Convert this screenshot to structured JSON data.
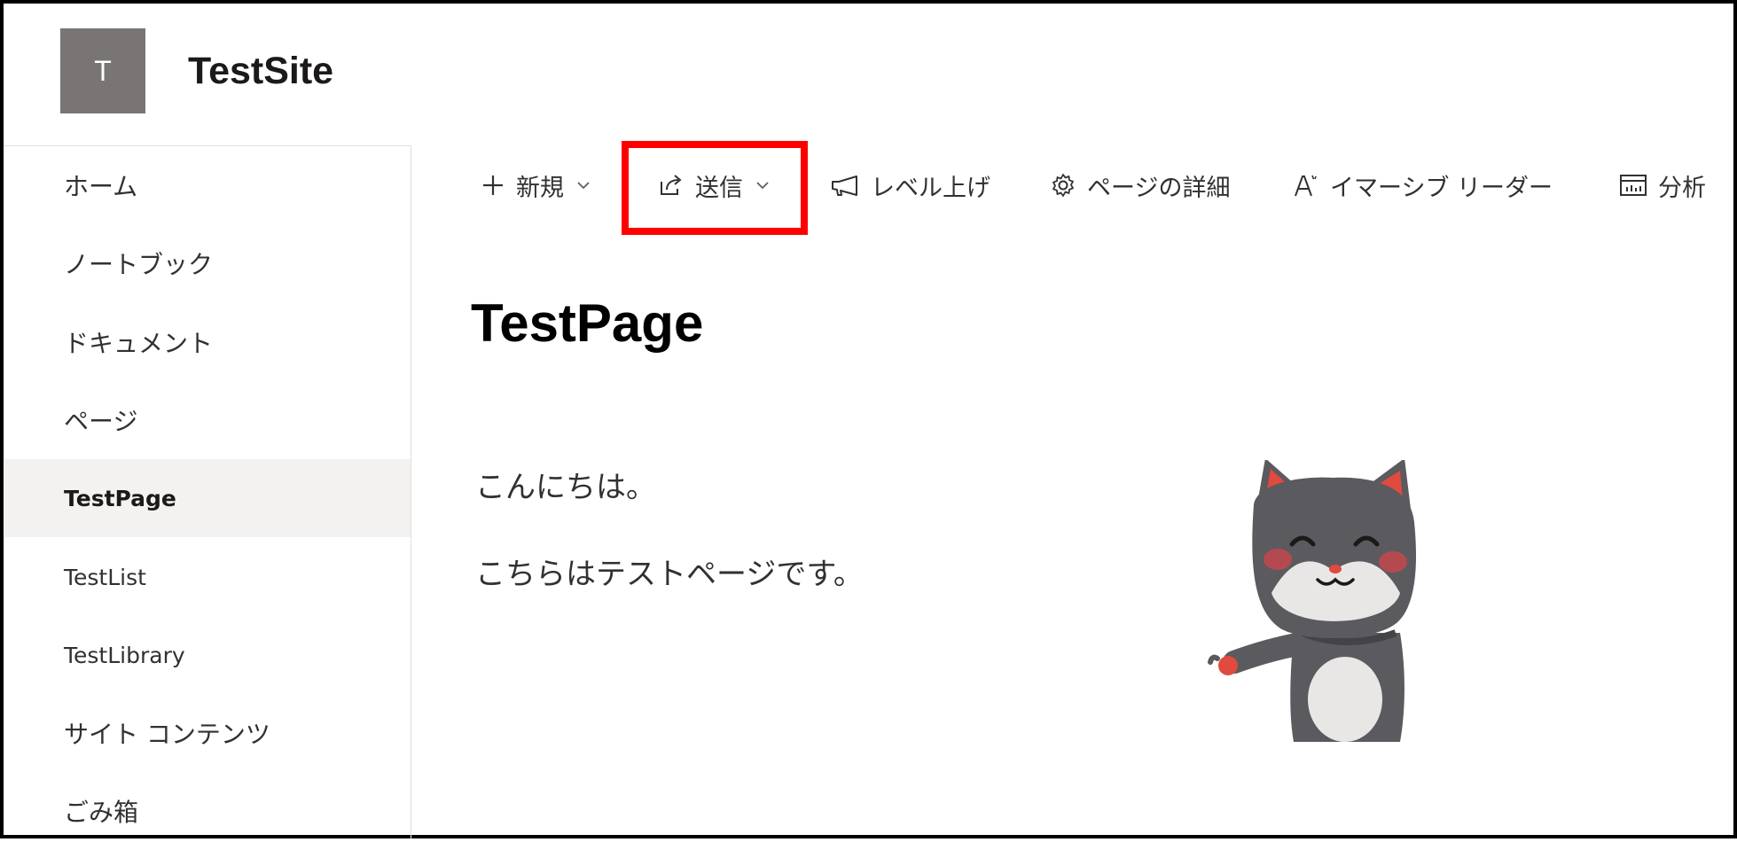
{
  "site": {
    "logo_letter": "T",
    "title": "TestSite"
  },
  "sidebar": {
    "items": [
      {
        "label": "ホーム"
      },
      {
        "label": "ノートブック"
      },
      {
        "label": "ドキュメント"
      },
      {
        "label": "ページ"
      },
      {
        "label": "TestPage",
        "selected": true
      },
      {
        "label": "TestList"
      },
      {
        "label": "TestLibrary"
      },
      {
        "label": "サイト コンテンツ"
      },
      {
        "label": "ごみ箱"
      }
    ]
  },
  "commandbar": {
    "new_label": "新規",
    "send_label": "送信",
    "promote_label": "レベル上げ",
    "page_details_label": "ページの詳細",
    "immersive_reader_label": "イマーシブ リーダー",
    "analytics_label": "分析",
    "highlight_color": "#ff0000"
  },
  "content": {
    "page_title": "TestPage",
    "paragraphs": [
      "こんにちは。",
      "こちらはテストページです。"
    ]
  }
}
